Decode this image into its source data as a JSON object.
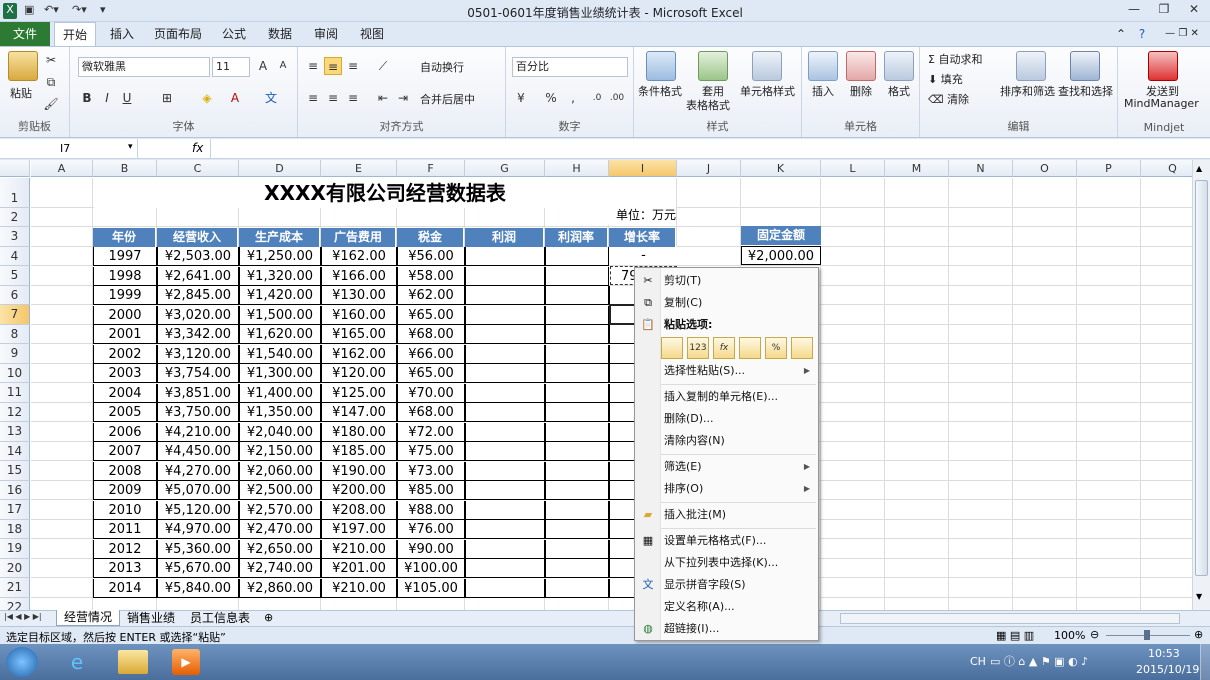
{
  "window": {
    "title": "0501-0601年度销售业绩统计表 - Microsoft Excel"
  },
  "tabs": [
    "文件",
    "开始",
    "插入",
    "页面布局",
    "公式",
    "数据",
    "审阅",
    "视图"
  ],
  "ribbon": {
    "clipboard": {
      "paste": "粘贴",
      "label": "剪贴板"
    },
    "font": {
      "name": "微软雅黑",
      "size": "11",
      "label": "字体"
    },
    "alignment": {
      "wrap": "自动换行",
      "merge": "合并后居中",
      "label": "对齐方式"
    },
    "number": {
      "format": "百分比",
      "label": "数字"
    },
    "styles": {
      "conditional": "条件格式",
      "table_line1": "套用",
      "table_line2": "表格格式",
      "cell_styles": "单元格样式",
      "label": "样式"
    },
    "cells": {
      "insert": "插入",
      "delete": "删除",
      "format": "格式",
      "label": "单元格"
    },
    "editing": {
      "autosum": "自动求和",
      "fill": "填充",
      "clear": "清除",
      "sort": "排序和筛选",
      "find": "查找和选择",
      "label": "编辑"
    },
    "mindjet": {
      "send_line1": "发送到",
      "send_line2": "MindManager",
      "label": "Mindjet"
    }
  },
  "formula_bar": {
    "name_box": "I7",
    "fx": "fx",
    "value": ""
  },
  "columns": [
    "A",
    "B",
    "C",
    "D",
    "E",
    "F",
    "G",
    "H",
    "I",
    "J",
    "K",
    "L",
    "M",
    "N",
    "O",
    "P",
    "Q"
  ],
  "rows": [
    "1",
    "2",
    "3",
    "4",
    "5",
    "6",
    "7",
    "8",
    "9",
    "10",
    "11",
    "12",
    "13",
    "14",
    "15",
    "16",
    "17",
    "18",
    "19",
    "20",
    "21",
    "22"
  ],
  "sheet": {
    "title": "XXXX有限公司经营数据表",
    "unit": "单位：万元",
    "headers": [
      "年份",
      "经营收入",
      "生产成本",
      "广告费用",
      "税金",
      "利润",
      "利润率",
      "增长率"
    ],
    "fixed_header": "固定金额",
    "fixed_value": "¥2,000.00",
    "growth_first": "-",
    "growth_partial": "79",
    "data": [
      [
        "1997",
        "¥2,503.00",
        "¥1,250.00",
        "¥162.00",
        "¥56.00"
      ],
      [
        "1998",
        "¥2,641.00",
        "¥1,320.00",
        "¥166.00",
        "¥58.00"
      ],
      [
        "1999",
        "¥2,845.00",
        "¥1,420.00",
        "¥130.00",
        "¥62.00"
      ],
      [
        "2000",
        "¥3,020.00",
        "¥1,500.00",
        "¥160.00",
        "¥65.00"
      ],
      [
        "2001",
        "¥3,342.00",
        "¥1,620.00",
        "¥165.00",
        "¥68.00"
      ],
      [
        "2002",
        "¥3,120.00",
        "¥1,540.00",
        "¥162.00",
        "¥66.00"
      ],
      [
        "2003",
        "¥3,754.00",
        "¥1,300.00",
        "¥120.00",
        "¥65.00"
      ],
      [
        "2004",
        "¥3,851.00",
        "¥1,400.00",
        "¥125.00",
        "¥70.00"
      ],
      [
        "2005",
        "¥3,750.00",
        "¥1,350.00",
        "¥147.00",
        "¥68.00"
      ],
      [
        "2006",
        "¥4,210.00",
        "¥2,040.00",
        "¥180.00",
        "¥72.00"
      ],
      [
        "2007",
        "¥4,450.00",
        "¥2,150.00",
        "¥185.00",
        "¥75.00"
      ],
      [
        "2008",
        "¥4,270.00",
        "¥2,060.00",
        "¥190.00",
        "¥73.00"
      ],
      [
        "2009",
        "¥5,070.00",
        "¥2,500.00",
        "¥200.00",
        "¥85.00"
      ],
      [
        "2010",
        "¥5,120.00",
        "¥2,570.00",
        "¥208.00",
        "¥88.00"
      ],
      [
        "2011",
        "¥4,970.00",
        "¥2,470.00",
        "¥197.00",
        "¥76.00"
      ],
      [
        "2012",
        "¥5,360.00",
        "¥2,650.00",
        "¥210.00",
        "¥90.00"
      ],
      [
        "2013",
        "¥5,670.00",
        "¥2,740.00",
        "¥201.00",
        "¥100.00"
      ],
      [
        "2014",
        "¥5,840.00",
        "¥2,860.00",
        "¥210.00",
        "¥105.00"
      ]
    ]
  },
  "sheet_tabs": [
    "经营情况",
    "销售业绩",
    "员工信息表"
  ],
  "status": {
    "message": "选定目标区域，然后按 ENTER 或选择“粘贴”",
    "zoom": "100%"
  },
  "context_menu": {
    "cut": "剪切(T)",
    "copy": "复制(C)",
    "paste_options": "粘贴选项:",
    "paste_icons": [
      "",
      "123",
      "fx",
      "",
      "%",
      ""
    ],
    "paste_special": "选择性粘贴(S)...",
    "insert_copied": "插入复制的单元格(E)...",
    "delete": "删除(D)...",
    "clear": "清除内容(N)",
    "filter": "筛选(E)",
    "sort": "排序(O)",
    "insert_comment": "插入批注(M)",
    "format_cells": "设置单元格格式(F)...",
    "pick_list": "从下拉列表中选择(K)...",
    "phonetic": "显示拼音字段(S)",
    "define_name": "定义名称(A)...",
    "hyperlink": "超链接(I)..."
  },
  "taskbar": {
    "lang": "CH",
    "time": "10:53",
    "date": "2015/10/19"
  },
  "colors": {
    "header_fill": "#4f81bd",
    "file_tab": "#2c7a33"
  }
}
